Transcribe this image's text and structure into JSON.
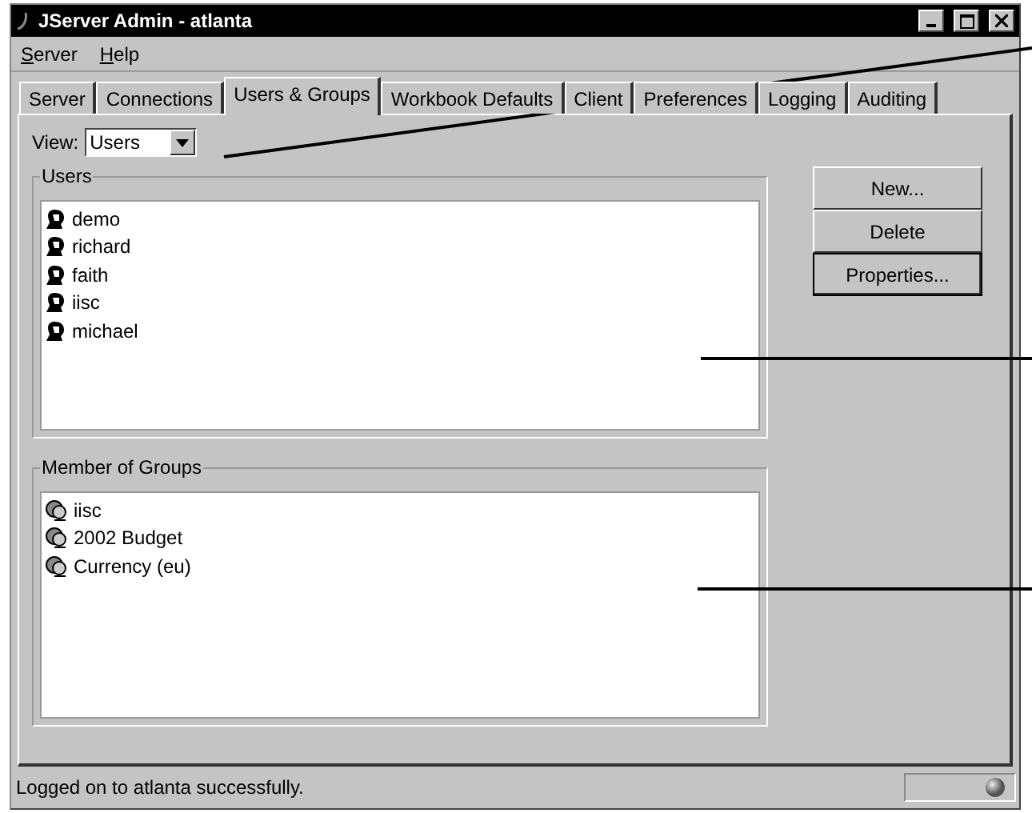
{
  "window": {
    "title": "JServer Admin - atlanta"
  },
  "menu": [
    "Server",
    "Help"
  ],
  "tabs": [
    {
      "label": "Server",
      "selected": false
    },
    {
      "label": "Connections",
      "selected": false
    },
    {
      "label": "Users & Groups",
      "selected": true
    },
    {
      "label": "Workbook Defaults",
      "selected": false
    },
    {
      "label": "Client",
      "selected": false
    },
    {
      "label": "Preferences",
      "selected": false
    },
    {
      "label": "Logging",
      "selected": false
    },
    {
      "label": "Auditing",
      "selected": false
    }
  ],
  "view": {
    "label": "View:",
    "value": "Users"
  },
  "users": {
    "title": "Users",
    "items": [
      "demo",
      "richard",
      "faith",
      "iisc",
      "michael"
    ]
  },
  "groups": {
    "title": "Member of Groups",
    "items": [
      "iisc",
      "2002 Budget",
      "Currency (eu)"
    ]
  },
  "buttons": [
    {
      "label": "New...",
      "default": false
    },
    {
      "label": "Delete",
      "default": false
    },
    {
      "label": "Properties...",
      "default": true
    }
  ],
  "status_bar": {
    "text": "Logged on to atlanta successfully."
  }
}
